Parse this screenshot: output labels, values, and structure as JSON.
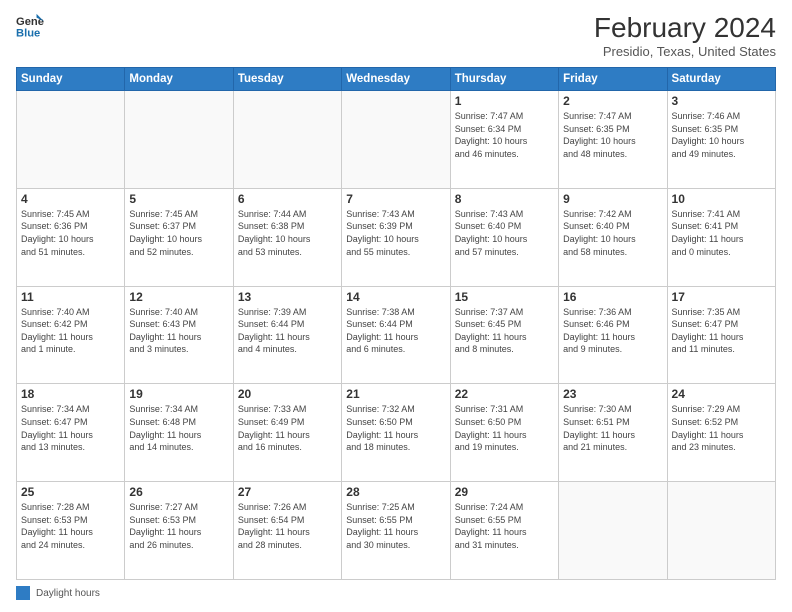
{
  "logo": {
    "line1": "General",
    "line2": "Blue"
  },
  "title": "February 2024",
  "location": "Presidio, Texas, United States",
  "days_of_week": [
    "Sunday",
    "Monday",
    "Tuesday",
    "Wednesday",
    "Thursday",
    "Friday",
    "Saturday"
  ],
  "footer": {
    "legend_label": "Daylight hours"
  },
  "weeks": [
    [
      {
        "day": "",
        "info": ""
      },
      {
        "day": "",
        "info": ""
      },
      {
        "day": "",
        "info": ""
      },
      {
        "day": "",
        "info": ""
      },
      {
        "day": "1",
        "info": "Sunrise: 7:47 AM\nSunset: 6:34 PM\nDaylight: 10 hours\nand 46 minutes."
      },
      {
        "day": "2",
        "info": "Sunrise: 7:47 AM\nSunset: 6:35 PM\nDaylight: 10 hours\nand 48 minutes."
      },
      {
        "day": "3",
        "info": "Sunrise: 7:46 AM\nSunset: 6:35 PM\nDaylight: 10 hours\nand 49 minutes."
      }
    ],
    [
      {
        "day": "4",
        "info": "Sunrise: 7:45 AM\nSunset: 6:36 PM\nDaylight: 10 hours\nand 51 minutes."
      },
      {
        "day": "5",
        "info": "Sunrise: 7:45 AM\nSunset: 6:37 PM\nDaylight: 10 hours\nand 52 minutes."
      },
      {
        "day": "6",
        "info": "Sunrise: 7:44 AM\nSunset: 6:38 PM\nDaylight: 10 hours\nand 53 minutes."
      },
      {
        "day": "7",
        "info": "Sunrise: 7:43 AM\nSunset: 6:39 PM\nDaylight: 10 hours\nand 55 minutes."
      },
      {
        "day": "8",
        "info": "Sunrise: 7:43 AM\nSunset: 6:40 PM\nDaylight: 10 hours\nand 57 minutes."
      },
      {
        "day": "9",
        "info": "Sunrise: 7:42 AM\nSunset: 6:40 PM\nDaylight: 10 hours\nand 58 minutes."
      },
      {
        "day": "10",
        "info": "Sunrise: 7:41 AM\nSunset: 6:41 PM\nDaylight: 11 hours\nand 0 minutes."
      }
    ],
    [
      {
        "day": "11",
        "info": "Sunrise: 7:40 AM\nSunset: 6:42 PM\nDaylight: 11 hours\nand 1 minute."
      },
      {
        "day": "12",
        "info": "Sunrise: 7:40 AM\nSunset: 6:43 PM\nDaylight: 11 hours\nand 3 minutes."
      },
      {
        "day": "13",
        "info": "Sunrise: 7:39 AM\nSunset: 6:44 PM\nDaylight: 11 hours\nand 4 minutes."
      },
      {
        "day": "14",
        "info": "Sunrise: 7:38 AM\nSunset: 6:44 PM\nDaylight: 11 hours\nand 6 minutes."
      },
      {
        "day": "15",
        "info": "Sunrise: 7:37 AM\nSunset: 6:45 PM\nDaylight: 11 hours\nand 8 minutes."
      },
      {
        "day": "16",
        "info": "Sunrise: 7:36 AM\nSunset: 6:46 PM\nDaylight: 11 hours\nand 9 minutes."
      },
      {
        "day": "17",
        "info": "Sunrise: 7:35 AM\nSunset: 6:47 PM\nDaylight: 11 hours\nand 11 minutes."
      }
    ],
    [
      {
        "day": "18",
        "info": "Sunrise: 7:34 AM\nSunset: 6:47 PM\nDaylight: 11 hours\nand 13 minutes."
      },
      {
        "day": "19",
        "info": "Sunrise: 7:34 AM\nSunset: 6:48 PM\nDaylight: 11 hours\nand 14 minutes."
      },
      {
        "day": "20",
        "info": "Sunrise: 7:33 AM\nSunset: 6:49 PM\nDaylight: 11 hours\nand 16 minutes."
      },
      {
        "day": "21",
        "info": "Sunrise: 7:32 AM\nSunset: 6:50 PM\nDaylight: 11 hours\nand 18 minutes."
      },
      {
        "day": "22",
        "info": "Sunrise: 7:31 AM\nSunset: 6:50 PM\nDaylight: 11 hours\nand 19 minutes."
      },
      {
        "day": "23",
        "info": "Sunrise: 7:30 AM\nSunset: 6:51 PM\nDaylight: 11 hours\nand 21 minutes."
      },
      {
        "day": "24",
        "info": "Sunrise: 7:29 AM\nSunset: 6:52 PM\nDaylight: 11 hours\nand 23 minutes."
      }
    ],
    [
      {
        "day": "25",
        "info": "Sunrise: 7:28 AM\nSunset: 6:53 PM\nDaylight: 11 hours\nand 24 minutes."
      },
      {
        "day": "26",
        "info": "Sunrise: 7:27 AM\nSunset: 6:53 PM\nDaylight: 11 hours\nand 26 minutes."
      },
      {
        "day": "27",
        "info": "Sunrise: 7:26 AM\nSunset: 6:54 PM\nDaylight: 11 hours\nand 28 minutes."
      },
      {
        "day": "28",
        "info": "Sunrise: 7:25 AM\nSunset: 6:55 PM\nDaylight: 11 hours\nand 30 minutes."
      },
      {
        "day": "29",
        "info": "Sunrise: 7:24 AM\nSunset: 6:55 PM\nDaylight: 11 hours\nand 31 minutes."
      },
      {
        "day": "",
        "info": ""
      },
      {
        "day": "",
        "info": ""
      }
    ]
  ]
}
